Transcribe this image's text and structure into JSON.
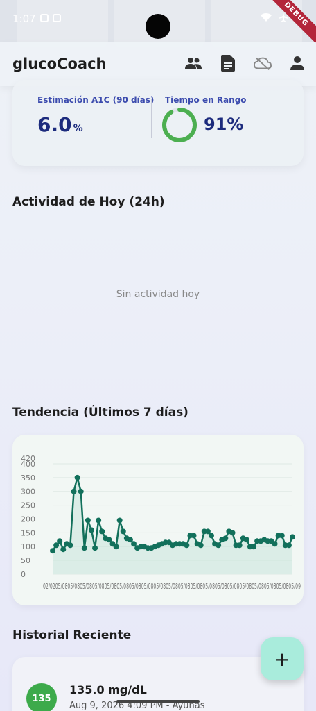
{
  "status": {
    "time": "1:07"
  },
  "debug_label": "DEBUG",
  "appbar": {
    "title": "glucoCoach",
    "actions": [
      "people-icon",
      "document-icon",
      "cloud-off-icon",
      "account-icon"
    ]
  },
  "summary": {
    "a1c_label": "Estimación A1C (90 días)",
    "a1c_value": "6.0",
    "a1c_unit": "%",
    "tir_label": "Tiempo en Rango",
    "tir_value": "91%",
    "tir_fraction": 0.91,
    "tir_color": "#4caf50"
  },
  "today": {
    "title": "Actividad de Hoy (24h)",
    "empty": "Sin actividad hoy"
  },
  "trend": {
    "title": "Tendencia (Últimos 7 días)"
  },
  "chart_data": {
    "type": "line",
    "y_ticks": [
      "0",
      "50",
      "100",
      "150",
      "200",
      "250",
      "300",
      "350",
      "400",
      "420"
    ],
    "ylim": [
      0,
      420
    ],
    "x_tick_text": "02/0205/0805/0805/0805/0805/0805/0805/0805/0805/0805/0805/0805/0805/0805/0805/0805/0805/0805/0805/0805/09",
    "values": [
      85,
      105,
      120,
      90,
      110,
      105,
      300,
      350,
      300,
      95,
      195,
      160,
      95,
      195,
      155,
      130,
      125,
      110,
      100,
      195,
      155,
      130,
      125,
      110,
      95,
      100,
      100,
      95,
      95,
      100,
      105,
      110,
      115,
      115,
      105,
      110,
      110,
      110,
      105,
      140,
      140,
      110,
      105,
      155,
      155,
      140,
      110,
      105,
      125,
      130,
      155,
      150,
      105,
      105,
      130,
      125,
      100,
      100,
      120,
      120,
      125,
      120,
      120,
      110,
      140,
      140,
      105,
      105,
      135
    ],
    "line_color": "#12705b",
    "fill_color": "#c9e6dc"
  },
  "history": {
    "title": "Historial Reciente",
    "badge": "135",
    "value": "135.0 mg/dL",
    "subtitle": "Aug 9, 2026 4:09 PM - Ayunas",
    "badge_color": "#3daa4b"
  },
  "fab_label": "+"
}
